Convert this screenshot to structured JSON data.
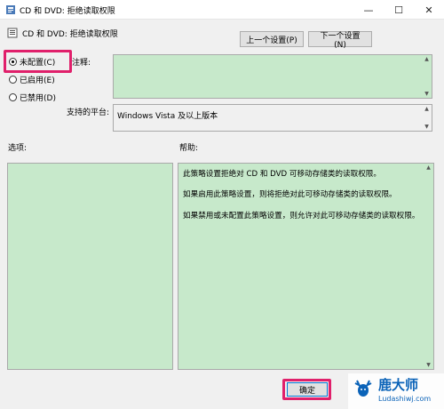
{
  "window": {
    "title": "CD 和 DVD: 拒绝读取权限",
    "controls": {
      "minimize": "—",
      "maximize": "☐",
      "close": "✕"
    }
  },
  "header": {
    "title": "CD 和 DVD: 拒绝读取权限",
    "prev_label": "上一个设置(P)",
    "next_label": "下一个设置(N)"
  },
  "radios": [
    {
      "label": "未配置(C)",
      "selected": true
    },
    {
      "label": "已启用(E)",
      "selected": false
    },
    {
      "label": "已禁用(D)",
      "selected": false
    }
  ],
  "comment": {
    "label": "注释:",
    "value": ""
  },
  "platform": {
    "label": "支持的平台:",
    "value": "Windows Vista 及以上版本"
  },
  "options": {
    "label": "选项:"
  },
  "help": {
    "label": "帮助:",
    "paragraphs": [
      "此策略设置拒绝对 CD 和 DVD 可移动存储类的读取权限。",
      "如果启用此策略设置，则将拒绝对此可移动存储类的读取权限。",
      "如果禁用或未配置此策略设置，则允许对此可移动存储类的读取权限。"
    ]
  },
  "footer": {
    "ok_label": "确定"
  },
  "watermark": {
    "name": "鹿大师",
    "url": "Ludashiwj.com"
  },
  "colors": {
    "highlight": "#e0206b",
    "panel_green": "#c7e9cb",
    "brand_blue": "#0b63b8"
  }
}
